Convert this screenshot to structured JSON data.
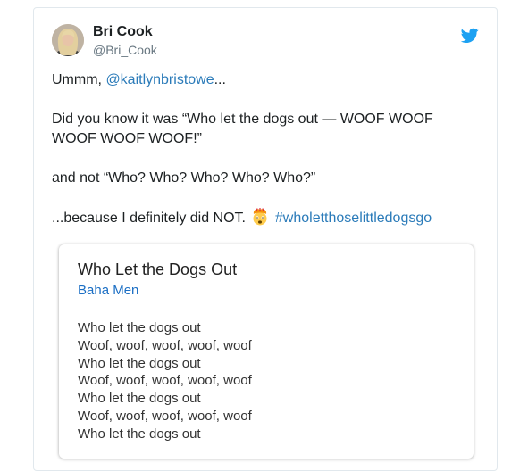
{
  "tweet": {
    "display_name": "Bri Cook",
    "handle": "@Bri_Cook",
    "line1_prefix": "Ummm, ",
    "mention": "@kaitlynbristowe",
    "line1_suffix": "...",
    "para2": "Did you know it was “Who let the dogs out — WOOF WOOF WOOF WOOF WOOF!”",
    "para3": "and not “Who? Who? Who? Who? Who?”",
    "para4_prefix": "...because I definitely did NOT. ",
    "hashtag": "#wholetthoselittledogsgo"
  },
  "card": {
    "song_title": "Who Let the Dogs Out",
    "artist": "Baha Men",
    "lyrics": [
      "Who let the dogs out",
      "Woof, woof, woof, woof, woof",
      "Who let the dogs out",
      "Woof, woof, woof, woof, woof",
      "Who let the dogs out",
      "Woof, woof, woof, woof, woof",
      "Who let the dogs out"
    ]
  },
  "icons": {
    "brand": "twitter-bird-icon",
    "emoji": "exploding-head-emoji"
  },
  "colors": {
    "link": "#2b7bb9",
    "twitter_blue": "#1da1f2",
    "artist_link": "#1a6ec4"
  }
}
